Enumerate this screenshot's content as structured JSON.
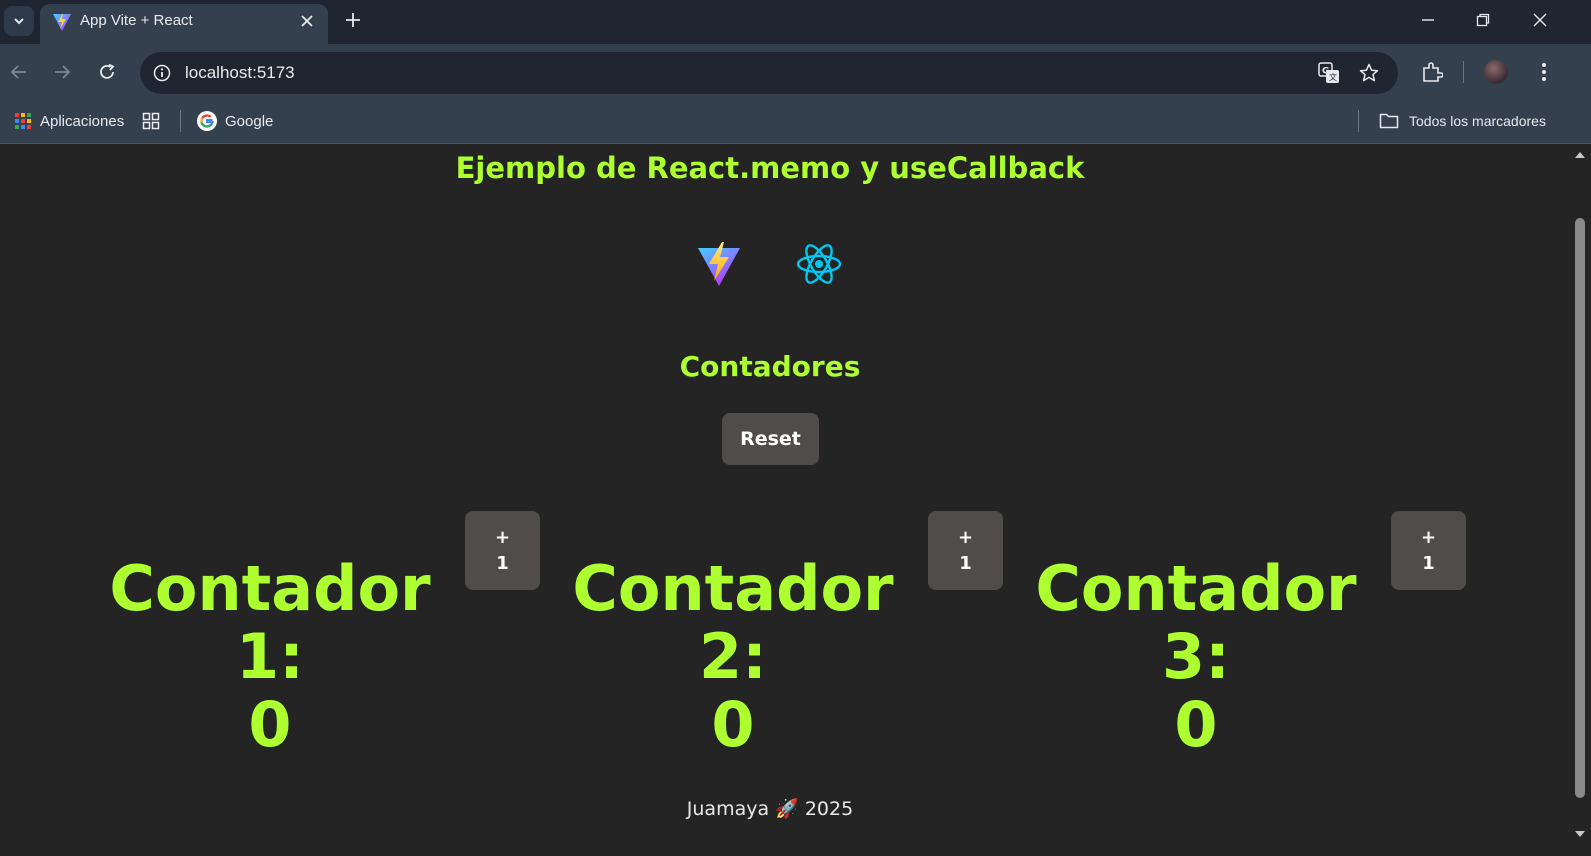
{
  "browser": {
    "tab_title": "App Vite + React",
    "url": "localhost:5173",
    "bookmarks": {
      "apps_label": "Aplicaciones",
      "google_label": "Google",
      "all_bookmarks_label": "Todos los marcadores"
    }
  },
  "page": {
    "title": "Ejemplo de React.memo y useCallback",
    "section_title": "Contadores",
    "reset_label": "Reset",
    "counters": [
      {
        "label": "Contador 1:",
        "value": "0",
        "button_label": "+\n1"
      },
      {
        "label": "Contador 2:",
        "value": "0",
        "button_label": "+\n1"
      },
      {
        "label": "Contador 3:",
        "value": "0",
        "button_label": "+\n1"
      }
    ],
    "footer": "Juamaya 🚀 2025"
  },
  "colors": {
    "accent": "#adff2f",
    "background": "#242424",
    "button_bg": "#514c4c"
  }
}
